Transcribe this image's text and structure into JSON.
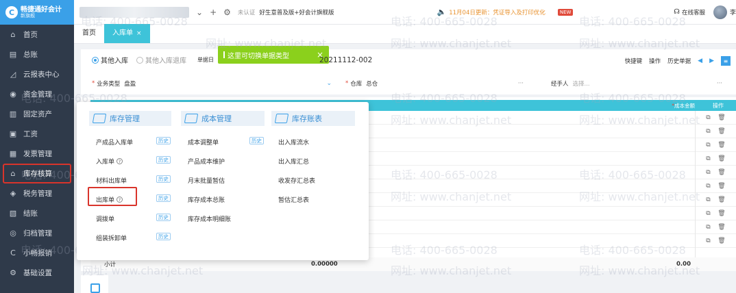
{
  "app": {
    "logo_line1": "畅捷通好会计",
    "logo_line2": "新旗舰",
    "logo_glyph": "C"
  },
  "sidebar": {
    "items": [
      {
        "label": "首页",
        "icon": "home-icon"
      },
      {
        "label": "总账",
        "icon": "ledger-icon"
      },
      {
        "label": "云报表中心",
        "icon": "chart-icon"
      },
      {
        "label": "资金管理",
        "icon": "money-icon"
      },
      {
        "label": "固定资产",
        "icon": "building-icon"
      },
      {
        "label": "工资",
        "icon": "salary-icon"
      },
      {
        "label": "发票管理",
        "icon": "invoice-icon"
      },
      {
        "label": "库存核算",
        "icon": "inventory-icon",
        "active": true
      },
      {
        "label": "税务管理",
        "icon": "tax-icon"
      },
      {
        "label": "结账",
        "icon": "close-book-icon"
      },
      {
        "label": "归档管理",
        "icon": "archive-icon"
      },
      {
        "label": "小畅报销",
        "icon": "reimburse-icon"
      },
      {
        "label": "基础设置",
        "icon": "settings-icon"
      }
    ]
  },
  "topbar": {
    "auth_status": "未认证",
    "plan": "好生意普及版+好会计旗舰版",
    "notice": "11月04日更新：凭证导入及打印优化",
    "new_badge": "NEW",
    "service": "在线客服",
    "user": "李"
  },
  "tabs": {
    "home": "首页",
    "active": "入库单",
    "close": "×"
  },
  "form": {
    "radio_in": "其他入库",
    "radio_return": "其他入库退库",
    "doc_label": "单据日",
    "doc_no": "20211112-002",
    "toast": "这里可切换单据类型",
    "toast_close": "×",
    "actions": {
      "shortcut": "快捷键",
      "operate": "操作",
      "history": "历史单据"
    },
    "biz_type_label": "业务类型",
    "biz_type_value": "盘盈",
    "warehouse_label": "仓库",
    "warehouse_value": "总仓",
    "handler_label": "经手人",
    "handler_placeholder": "选择...",
    "ellipsis": "···",
    "required_mark": "*"
  },
  "table": {
    "col_cost": "成本金额",
    "col_op": "操作",
    "subtotal_label": "小计",
    "subtotal_qty": "0.00000",
    "subtotal_amount": "0.00",
    "row_count": 10
  },
  "popup": {
    "columns": [
      {
        "title": "库存管理",
        "items": [
          {
            "label": "产成品入库单",
            "help": false,
            "hist": "历史"
          },
          {
            "label": "入库单",
            "help": true,
            "hist": "历史"
          },
          {
            "label": "材料出库单",
            "help": false,
            "hist": "历史"
          },
          {
            "label": "出库单",
            "help": true,
            "hist": "历史",
            "highlighted": true
          },
          {
            "label": "调拨单",
            "help": false,
            "hist": "历史"
          },
          {
            "label": "组装拆卸单",
            "help": false,
            "hist": "历史"
          }
        ]
      },
      {
        "title": "成本管理",
        "items": [
          {
            "label": "成本调整单",
            "help": false,
            "hist": "历史"
          },
          {
            "label": "产品成本维护",
            "help": false,
            "hist": ""
          },
          {
            "label": "月末批量暂估",
            "help": false,
            "hist": ""
          },
          {
            "label": "库存成本总账",
            "help": false,
            "hist": ""
          },
          {
            "label": "库存成本明细账",
            "help": false,
            "hist": ""
          }
        ]
      },
      {
        "title": "库存账表",
        "items": [
          {
            "label": "出入库流水",
            "help": false,
            "hist": ""
          },
          {
            "label": "出入库汇总",
            "help": false,
            "hist": ""
          },
          {
            "label": "收发存汇总表",
            "help": false,
            "hist": ""
          },
          {
            "label": "暂估汇总表",
            "help": false,
            "hist": ""
          }
        ]
      }
    ],
    "help_glyph": "?"
  },
  "watermark": {
    "phone": "电话: 400-665-0028",
    "url": "网址: www.chanjet.net"
  },
  "colors": {
    "sidebar_bg": "#2f3a4a",
    "accent": "#3ec3d9",
    "brand": "#3aa0e8",
    "highlight": "#d9342b",
    "toast": "#8bd01c"
  }
}
